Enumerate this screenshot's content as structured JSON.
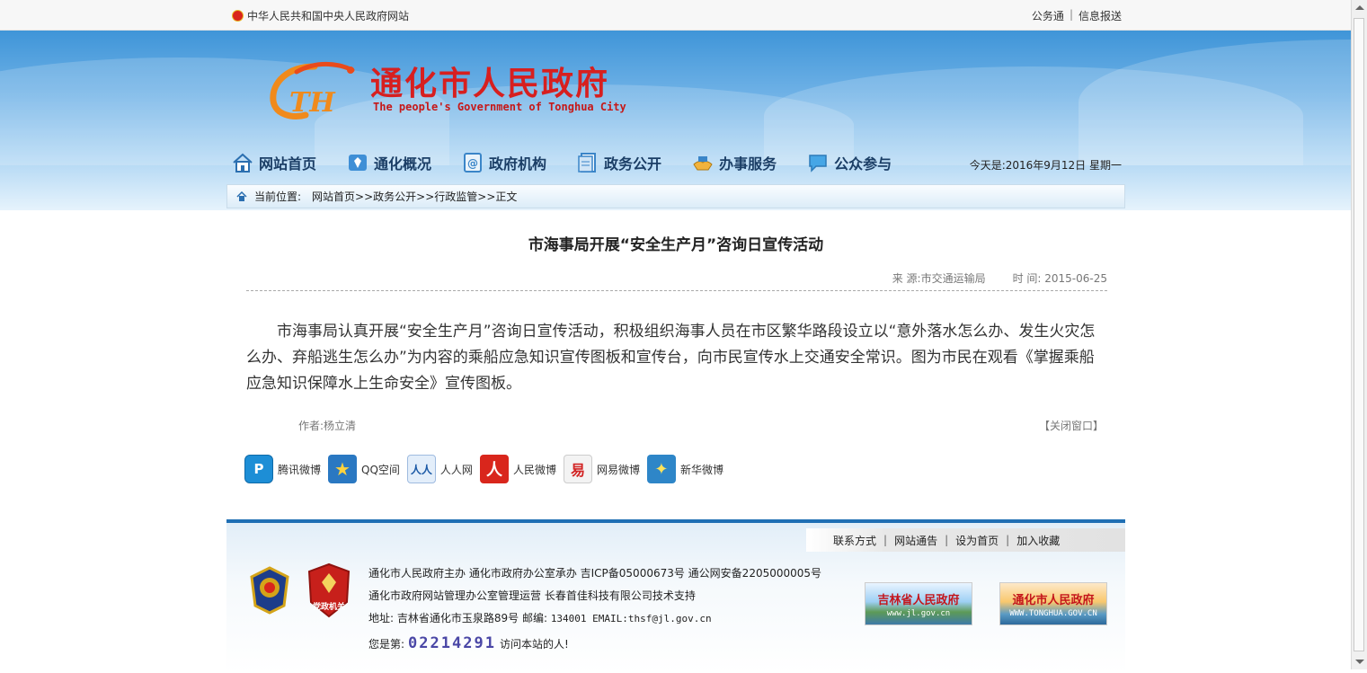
{
  "topbar": {
    "site_name": "中华人民共和国中央人民政府网站",
    "links": [
      "公务通",
      "信息报送"
    ],
    "sep": "|"
  },
  "logo": {
    "mark_text": "TH",
    "title_cn": "通化市人民政府",
    "title_en": "The people's Government of Tonghua City"
  },
  "nav": {
    "items": [
      {
        "label": "网站首页",
        "icon": "home-icon"
      },
      {
        "label": "通化概况",
        "icon": "overview-icon"
      },
      {
        "label": "政府机构",
        "icon": "organization-icon"
      },
      {
        "label": "政务公开",
        "icon": "document-icon"
      },
      {
        "label": "办事服务",
        "icon": "handshake-icon"
      },
      {
        "label": "公众参与",
        "icon": "chat-icon"
      }
    ],
    "date": "今天是:2016年9月12日   星期一"
  },
  "breadcrumb": {
    "label": "当前位置:",
    "path": "网站首页>>政务公开>>行政监管>>正文"
  },
  "article": {
    "title": "市海事局开展“安全生产月”咨询日宣传活动",
    "source": "来 源:市交通运输局",
    "time": "时 间: 2015-06-25",
    "body": "市海事局认真开展“安全生产月”咨询日宣传活动，积极组织海事人员在市区繁华路段设立以“意外落水怎么办、发生火灾怎么办、弃船逃生怎么办”为内容的乘船应急知识宣传图板和宣传台，向市民宣传水上交通安全常识。图为市民在观看《掌握乘船应急知识保障水上生命安全》宣传图板。",
    "author": "作者:杨立清",
    "close_window": "【关闭窗口】"
  },
  "share": [
    {
      "label": "腾讯微博",
      "icon": "tencent-weibo-icon",
      "glyph": "P",
      "bg": "#1d8ed6"
    },
    {
      "label": "QQ空间",
      "icon": "qzone-icon",
      "glyph": "★",
      "bg": "#2a78c2"
    },
    {
      "label": "人人网",
      "icon": "renren-icon",
      "glyph": "人人",
      "bg": "#e3eefa"
    },
    {
      "label": "人民微博",
      "icon": "people-weibo-icon",
      "glyph": "人",
      "bg": "#d9261c"
    },
    {
      "label": "网易微博",
      "icon": "netease-weibo-icon",
      "glyph": "易",
      "bg": "#f3f3f3"
    },
    {
      "label": "新华微博",
      "icon": "xinhua-weibo-icon",
      "glyph": "✦",
      "bg": "#2e86c8"
    }
  ],
  "footer": {
    "links": [
      "联系方式",
      "网站通告",
      "设为首页",
      "加入收藏"
    ],
    "sep": "|",
    "line1": "通化市人民政府主办  通化市政府办公室承办  吉ICP备05000673号  通公网安备2205000005号",
    "line2": "通化市政府网站管理办公室管理运营  长春首佳科技有限公司技术支持",
    "line3_label": "地址: 吉林省通化市玉泉路89号  邮编: ",
    "line3_mono": "134001 EMAIL:thsf@jl.gov.cn",
    "visitor_prefix": "您是第:",
    "visitor_count": "02214291",
    "visitor_suffix": "访问本站的人!",
    "party_badge_text": "党政机关",
    "link1_title": "吉林省人民政府",
    "link1_url": "www.jl.gov.cn",
    "link2_title": "通化市人民政府",
    "link2_url": "WWW.TONGHUA.GOV.CN"
  },
  "colors": {
    "brand_red": "#d71f1f",
    "nav_text": "#1b3e66",
    "footer_accent": "#1f6fb4",
    "counter": "#4a47a6"
  }
}
